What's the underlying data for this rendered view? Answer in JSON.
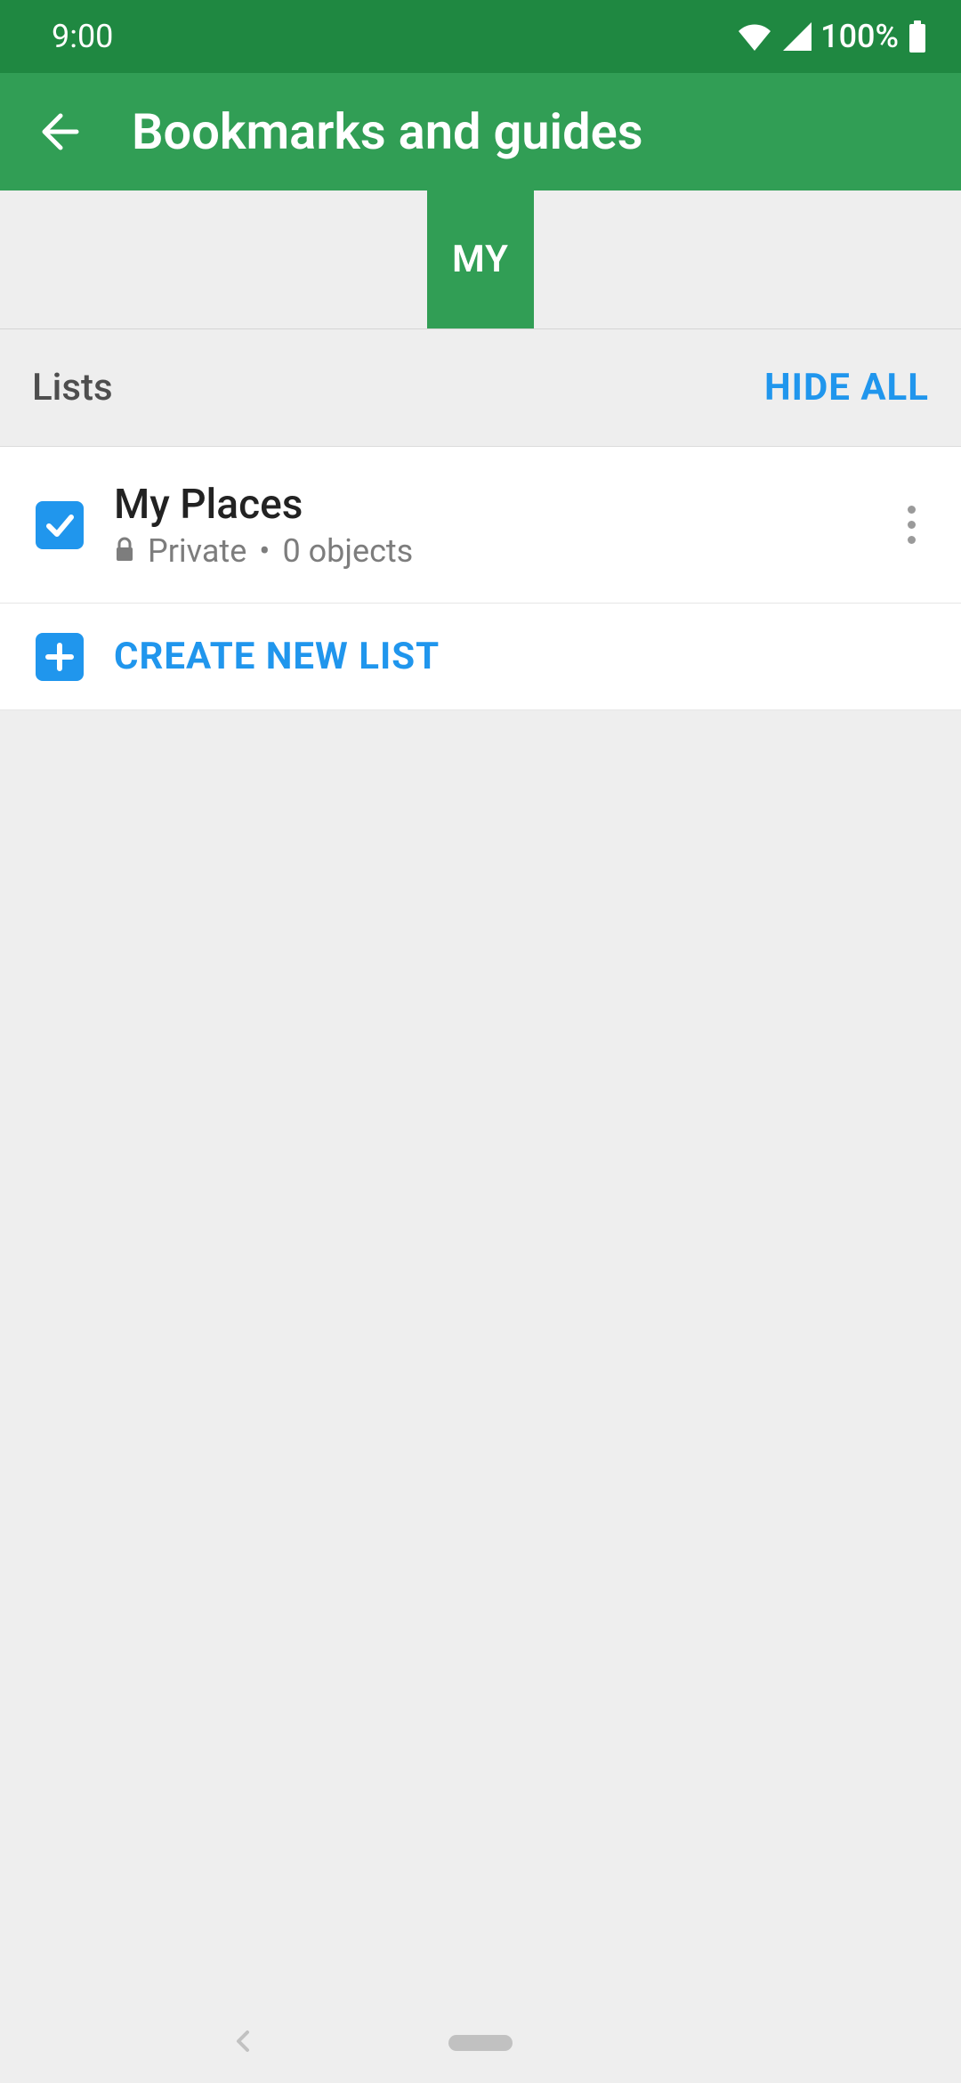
{
  "status": {
    "time": "9:00",
    "battery": "100%"
  },
  "header": {
    "title": "Bookmarks and guides"
  },
  "tabs": {
    "active": "MY"
  },
  "section": {
    "label": "Lists",
    "hide_all": "HIDE ALL"
  },
  "lists": [
    {
      "name": "My Places",
      "privacy": "Private",
      "count_text": "0 objects",
      "checked": true
    }
  ],
  "actions": {
    "create": "CREATE NEW LIST"
  }
}
